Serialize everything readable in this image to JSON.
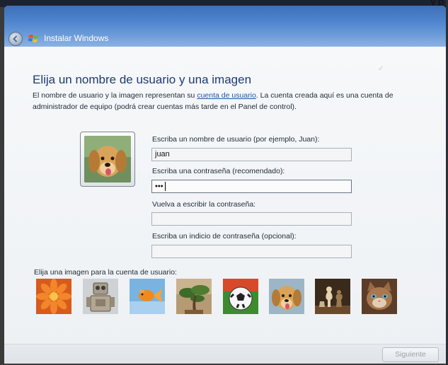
{
  "screen": {
    "corner_text": "y p"
  },
  "window": {
    "title": "Instalar Windows"
  },
  "page": {
    "heading": "Elija un nombre de usuario y una imagen",
    "description_before_link": "El nombre de usuario y la imagen representan su ",
    "description_link": "cuenta de usuario",
    "description_after_link": ". La cuenta creada aquí es una cuenta de administrador de equipo (podrá crear cuentas más tarde en el Panel de control)."
  },
  "avatar": {
    "icon": "dog-photo"
  },
  "form": {
    "username_label": "Escriba un nombre de usuario (por ejemplo, Juan):",
    "username_value": "juan",
    "password_label": "Escriba una contraseña (recomendado):",
    "password_value": "•••",
    "password_confirm_label": "Vuelva a escribir la contraseña:",
    "password_confirm_value": "",
    "hint_label": "Escriba un indicio de contraseña (opcional):",
    "hint_value": ""
  },
  "picture_picker": {
    "label": "Elija una imagen para la cuenta de usuario:",
    "images": [
      {
        "name": "flower"
      },
      {
        "name": "robot"
      },
      {
        "name": "goldfish"
      },
      {
        "name": "bonsai-tree"
      },
      {
        "name": "soccer-ball"
      },
      {
        "name": "dog"
      },
      {
        "name": "chess-pieces"
      },
      {
        "name": "kitten"
      }
    ]
  },
  "footer": {
    "next_label": "Siguiente"
  },
  "colors": {
    "titlebar": "#4f86cf",
    "heading": "#1d3b70",
    "link": "#2253a8"
  }
}
